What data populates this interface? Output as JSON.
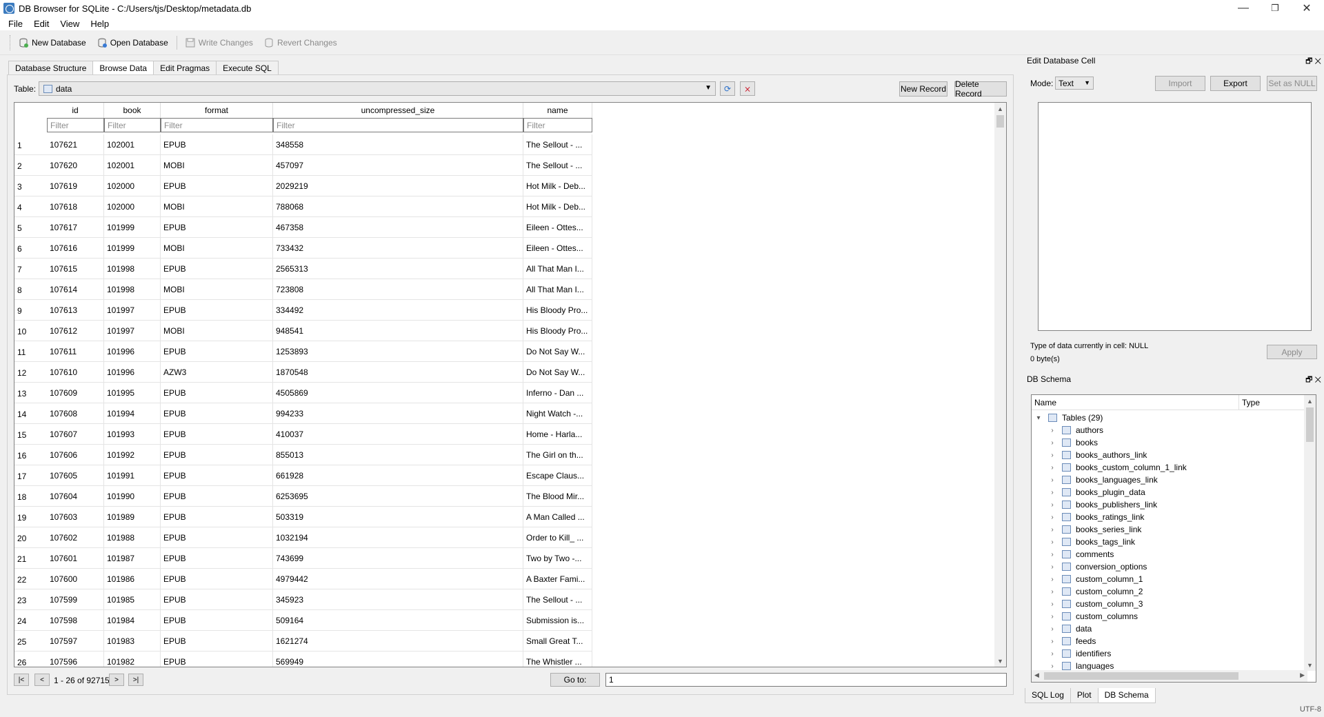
{
  "window": {
    "title": "DB Browser for SQLite - C:/Users/tjs/Desktop/metadata.db",
    "minimize": "—",
    "restore": "❐",
    "close": "✕"
  },
  "menu": [
    "File",
    "Edit",
    "View",
    "Help"
  ],
  "toolbar": {
    "new_database": "New Database",
    "open_database": "Open Database",
    "write_changes": "Write Changes",
    "revert_changes": "Revert Changes"
  },
  "tabs": [
    "Database Structure",
    "Browse Data",
    "Edit Pragmas",
    "Execute SQL"
  ],
  "active_tab": "Browse Data",
  "browse": {
    "table_label": "Table:",
    "table_value": "data",
    "new_record": "New Record",
    "delete_record": "Delete Record",
    "filter_placeholder": "Filter",
    "columns": [
      "id",
      "book",
      "format",
      "uncompressed_size",
      "name"
    ],
    "rows": [
      [
        "1",
        "107621",
        "102001",
        "EPUB",
        "348558",
        "The Sellout - ..."
      ],
      [
        "2",
        "107620",
        "102001",
        "MOBI",
        "457097",
        "The Sellout - ..."
      ],
      [
        "3",
        "107619",
        "102000",
        "EPUB",
        "2029219",
        "Hot Milk - Deb..."
      ],
      [
        "4",
        "107618",
        "102000",
        "MOBI",
        "788068",
        "Hot Milk - Deb..."
      ],
      [
        "5",
        "107617",
        "101999",
        "EPUB",
        "467358",
        "Eileen - Ottes..."
      ],
      [
        "6",
        "107616",
        "101999",
        "MOBI",
        "733432",
        "Eileen - Ottes..."
      ],
      [
        "7",
        "107615",
        "101998",
        "EPUB",
        "2565313",
        "All That Man I..."
      ],
      [
        "8",
        "107614",
        "101998",
        "MOBI",
        "723808",
        "All That Man I..."
      ],
      [
        "9",
        "107613",
        "101997",
        "EPUB",
        "334492",
        "His Bloody Pro..."
      ],
      [
        "10",
        "107612",
        "101997",
        "MOBI",
        "948541",
        "His Bloody Pro..."
      ],
      [
        "11",
        "107611",
        "101996",
        "EPUB",
        "1253893",
        "Do Not Say W..."
      ],
      [
        "12",
        "107610",
        "101996",
        "AZW3",
        "1870548",
        "Do Not Say W..."
      ],
      [
        "13",
        "107609",
        "101995",
        "EPUB",
        "4505869",
        "Inferno - Dan ..."
      ],
      [
        "14",
        "107608",
        "101994",
        "EPUB",
        "994233",
        "Night Watch -..."
      ],
      [
        "15",
        "107607",
        "101993",
        "EPUB",
        "410037",
        "Home - Harla..."
      ],
      [
        "16",
        "107606",
        "101992",
        "EPUB",
        "855013",
        "The Girl on th..."
      ],
      [
        "17",
        "107605",
        "101991",
        "EPUB",
        "661928",
        "Escape Claus..."
      ],
      [
        "18",
        "107604",
        "101990",
        "EPUB",
        "6253695",
        "The Blood Mir..."
      ],
      [
        "19",
        "107603",
        "101989",
        "EPUB",
        "503319",
        "A Man Called ..."
      ],
      [
        "20",
        "107602",
        "101988",
        "EPUB",
        "1032194",
        "Order to Kill_ ..."
      ],
      [
        "21",
        "107601",
        "101987",
        "EPUB",
        "743699",
        "Two by Two -..."
      ],
      [
        "22",
        "107600",
        "101986",
        "EPUB",
        "4979442",
        "A Baxter Fami..."
      ],
      [
        "23",
        "107599",
        "101985",
        "EPUB",
        "345923",
        "The Sellout - ..."
      ],
      [
        "24",
        "107598",
        "101984",
        "EPUB",
        "509164",
        "Submission is..."
      ],
      [
        "25",
        "107597",
        "101983",
        "EPUB",
        "1621274",
        "Small Great T..."
      ],
      [
        "26",
        "107596",
        "101982",
        "EPUB",
        "569949",
        "The Whistler ..."
      ]
    ],
    "nav_first": "|<",
    "nav_prev": "<",
    "nav_info": "1 - 26 of 92715",
    "nav_next": ">",
    "nav_last": ">|",
    "goto_label": "Go to:",
    "goto_value": "1"
  },
  "edit_cell": {
    "title": "Edit Database Cell",
    "mode_label": "Mode:",
    "mode_value": "Text",
    "import": "Import",
    "export": "Export",
    "set_null": "Set as NULL",
    "type_info": "Type of data currently in cell: NULL",
    "size_info": "0 byte(s)",
    "apply": "Apply"
  },
  "schema": {
    "title": "DB Schema",
    "col_name": "Name",
    "col_type": "Type",
    "root": "Tables (29)",
    "tables": [
      "authors",
      "books",
      "books_authors_link",
      "books_custom_column_1_link",
      "books_languages_link",
      "books_plugin_data",
      "books_publishers_link",
      "books_ratings_link",
      "books_series_link",
      "books_tags_link",
      "comments",
      "conversion_options",
      "custom_column_1",
      "custom_column_2",
      "custom_column_3",
      "custom_columns",
      "data",
      "feeds",
      "identifiers",
      "languages"
    ]
  },
  "bottom_tabs": [
    "SQL Log",
    "Plot",
    "DB Schema"
  ],
  "bottom_active": "DB Schema",
  "status": "UTF-8"
}
